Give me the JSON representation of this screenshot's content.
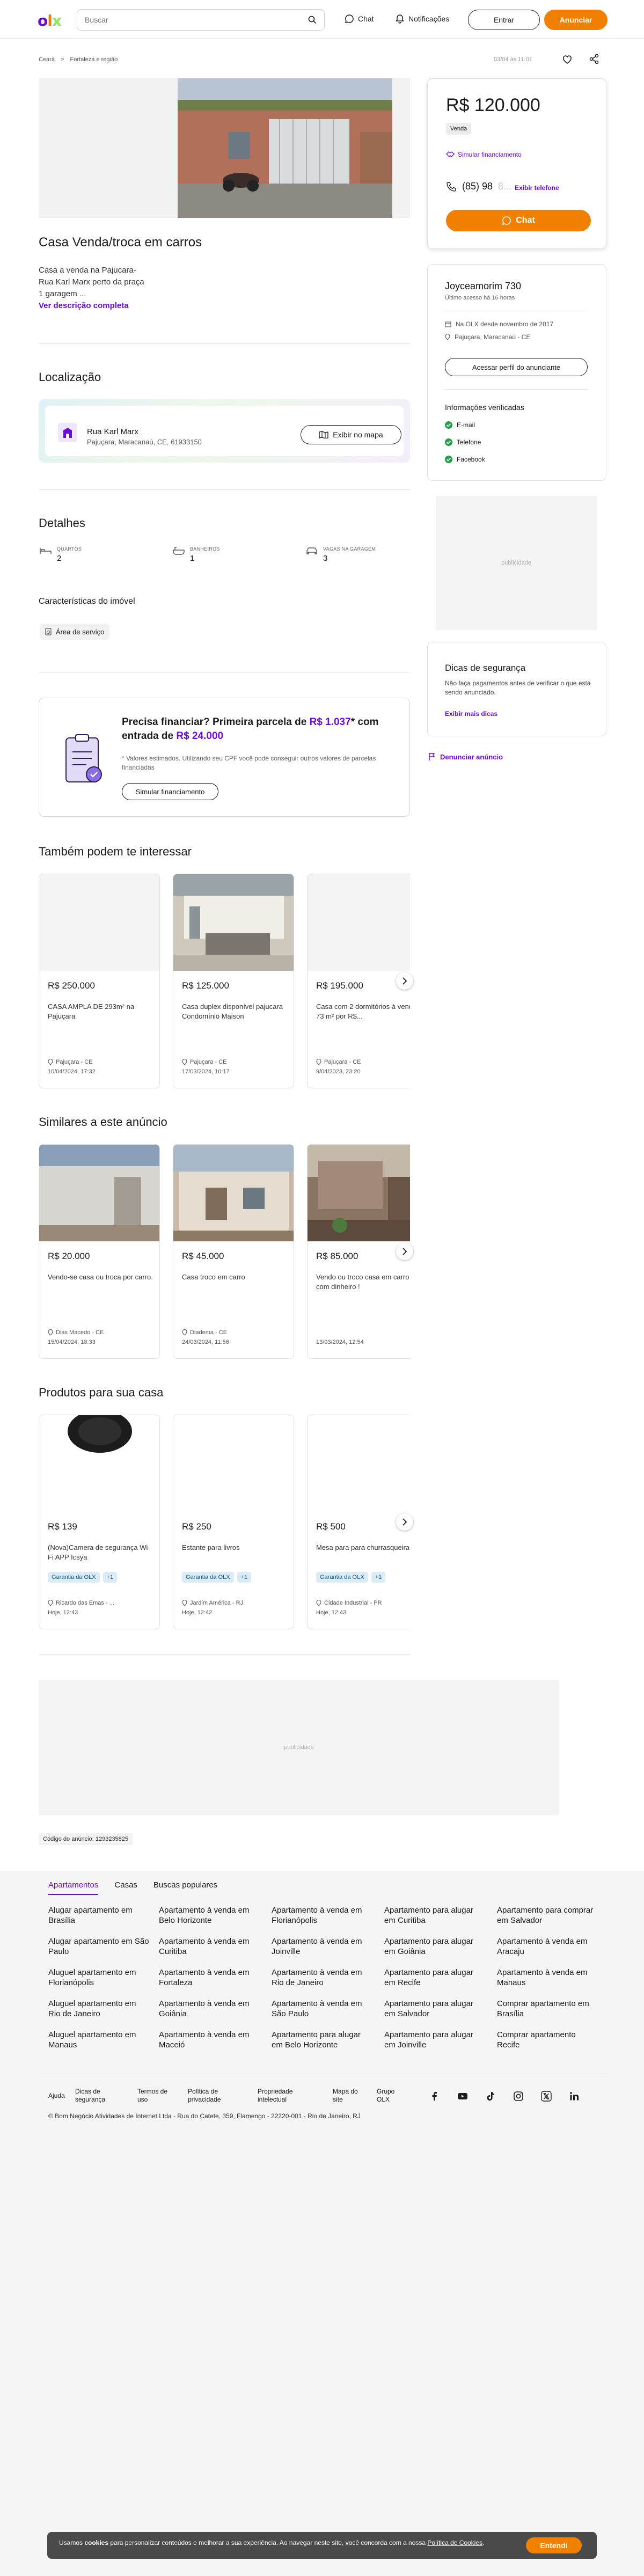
{
  "header": {
    "search_placeholder": "Buscar",
    "chat": "Chat",
    "notificacoes": "Notificações",
    "entrar": "Entrar",
    "anunciar": "Anunciar"
  },
  "breadcrumb": [
    "Ceará",
    ">",
    "Fortaleza e região"
  ],
  "ad_meta": "03/04 às 11:01",
  "listing": {
    "title": "Casa Venda/troca em carros",
    "description": [
      "Casa a venda na Pajucara-",
      "Rua Karl Marx perto da praça",
      "1 garagem ..."
    ],
    "see_more": "Ver descrição completa"
  },
  "location": {
    "heading": "Localização",
    "street": "Rua Karl Marx",
    "city": "Pajuçara, Maracanaú, CE, 61933150",
    "map_button": "Exibir no mapa"
  },
  "details": {
    "heading": "Detalhes",
    "items": [
      {
        "label": "QUARTOS",
        "value": "2"
      },
      {
        "label": "BANHEIROS",
        "value": "1"
      },
      {
        "label": "VAGAS NA GARAGEM",
        "value": "3"
      }
    ],
    "features_heading": "Características do imóvel",
    "features": [
      "Área de serviço"
    ]
  },
  "finance": {
    "title_a": "Precisa financiar? Primeira parcela de ",
    "title_b": "R$ 1.037",
    "title_c": "* com entrada de ",
    "title_d": "R$ 24.000",
    "note": "* Valores estimados. Utilizando seu CPF você pode conseguir outros valores de parcelas financiadas",
    "button": "Simular financiamento"
  },
  "interest": {
    "heading": "Também podem te interessar",
    "cards": [
      {
        "price": "R$ 250.000",
        "title": "CASA AMPLA DE 293m² na Pajuçara",
        "loc": "Pajuçara - CE",
        "date": "10/04/2024, 17:32"
      },
      {
        "price": "R$ 125.000",
        "title": "Casa duplex disponível pajucara Condomínio Maison",
        "loc": "Pajuçara - CE",
        "date": "17/03/2024, 10:17"
      },
      {
        "price": "R$ 195.000",
        "title": "Casa com 2 dormitórios à venda, 73 m² por R$...",
        "loc": "Pajuçara - CE",
        "date": "9/04/2023, 23:20"
      }
    ]
  },
  "similar": {
    "heading": "Similares a este anúncio",
    "cards": [
      {
        "price": "R$ 20.000",
        "title": "Vendo-se casa ou troca por carro.",
        "loc": "Dias Macedo - CE",
        "date": "15/04/2024, 18:33"
      },
      {
        "price": "R$ 45.000",
        "title": "Casa troco em carro",
        "loc": "Diadema - CE",
        "date": "24/03/2024, 11:56"
      },
      {
        "price": "R$ 85.000",
        "title": "Vendo ou troco casa em carro com dinheiro !",
        "loc": "",
        "date": "13/03/2024, 12:54"
      }
    ]
  },
  "products": {
    "heading": "Produtos para sua casa",
    "badge_label": "Garantia da OLX",
    "badge_more": "+1",
    "cards": [
      {
        "price": "R$ 139",
        "title": "(Nova)Camera de segurança Wi-Fi APP Icsya",
        "loc": "Ricardo das Emas - ...",
        "date": "Hoje, 12:43"
      },
      {
        "price": "R$ 250",
        "title": "Estante para livros",
        "loc": "Jardim América - RJ",
        "date": "Hoje, 12:42"
      },
      {
        "price": "R$ 500",
        "title": "Mesa para para churrasqueira",
        "loc": "Cidade Industrial - PR",
        "date": "Hoje, 12:43"
      }
    ]
  },
  "publicidade": "publicidade",
  "ad_code": "Código do anúncio: 1293235825",
  "sidebar": {
    "price": "R$ 120.000",
    "venda": "Venda",
    "simular": "Simular financiamento",
    "phone_visible": "(85) 98",
    "phone_masked": "8...",
    "phone_link": "Exibir telefone",
    "chat": "Chat",
    "seller_name": "Joyceamorim 730",
    "seller_seen": "Último acesso há 16 horas",
    "seller_since": "Na OLX desde novembro de 2017",
    "seller_loc": "Pajuçara, Maracanaú - CE",
    "seller_profile": "Acessar perfil do anunciante",
    "verified_heading": "Informações verificadas",
    "verified": [
      "E-mail",
      "Telefone",
      "Facebook"
    ],
    "dicas_title": "Dicas de segurança",
    "dicas_text": "Não faça pagamentos antes de verificar o que está sendo anunciado.",
    "dicas_link": "Exibir mais dicas",
    "denunciar": "Denunciar anúncio"
  },
  "footer": {
    "tabs": [
      "Apartamentos",
      "Casas",
      "Buscas populares"
    ],
    "columns": [
      [
        "Alugar apartamento em Brasília",
        "Alugar apartamento em São Paulo",
        "Aluguel apartamento em Florianópolis",
        "Aluguel apartamento em Rio de Janeiro",
        "Aluguel apartamento em Manaus"
      ],
      [
        "Apartamento à venda em Belo Horizonte",
        "Apartamento à venda em Curitiba",
        "Apartamento à venda em Fortaleza",
        "Apartamento à venda em Goiânia",
        "Apartamento à venda em Maceió"
      ],
      [
        "Apartamento à venda em Florianópolis",
        "Apartamento à venda em Joinville",
        "Apartamento à venda em Rio de Janeiro",
        "Apartamento à venda em São Paulo",
        "Apartamento para alugar em Belo Horizonte"
      ],
      [
        "Apartamento para alugar em Curitiba",
        "Apartamento para alugar em Goiânia",
        "Apartamento para alugar em Recife",
        "Apartamento para alugar em Salvador",
        "Apartamento para alugar em Joinville"
      ],
      [
        "Apartamento para comprar em Salvador",
        "Apartamento à venda em Aracaju",
        "Apartamento à venda em Manaus",
        "Comprar apartamento em Brasília",
        "Comprar apartamento Recife"
      ]
    ],
    "bottom_links": [
      [
        "Ajuda"
      ],
      [
        "Dicas de",
        "segurança"
      ],
      [
        "Termos de",
        "uso"
      ],
      [
        "Política de",
        "privacidade"
      ],
      [
        "Propriedade",
        "intelectual"
      ],
      [
        "Mapa do",
        "site"
      ],
      [
        "Grupo",
        "OLX"
      ]
    ],
    "copyright": "© Bom Negócio Atividades de Internet Ltda - Rua do Catete, 359, Flamengo - 22220-001 - Rio de Janeiro, RJ"
  },
  "cookie": {
    "text_a": "Usamos ",
    "text_b": "cookies",
    "text_c": " para personalizar conteúdos e melhorar a sua experiência. Ao navegar neste site, você concorda com a nossa ",
    "text_d": "Política de Cookies",
    "text_e": ".",
    "button": "Entendi"
  },
  "colors": {
    "brand_purple": "#6e0ad6",
    "brand_orange": "#f28000",
    "brand_green": "#8ce563"
  }
}
